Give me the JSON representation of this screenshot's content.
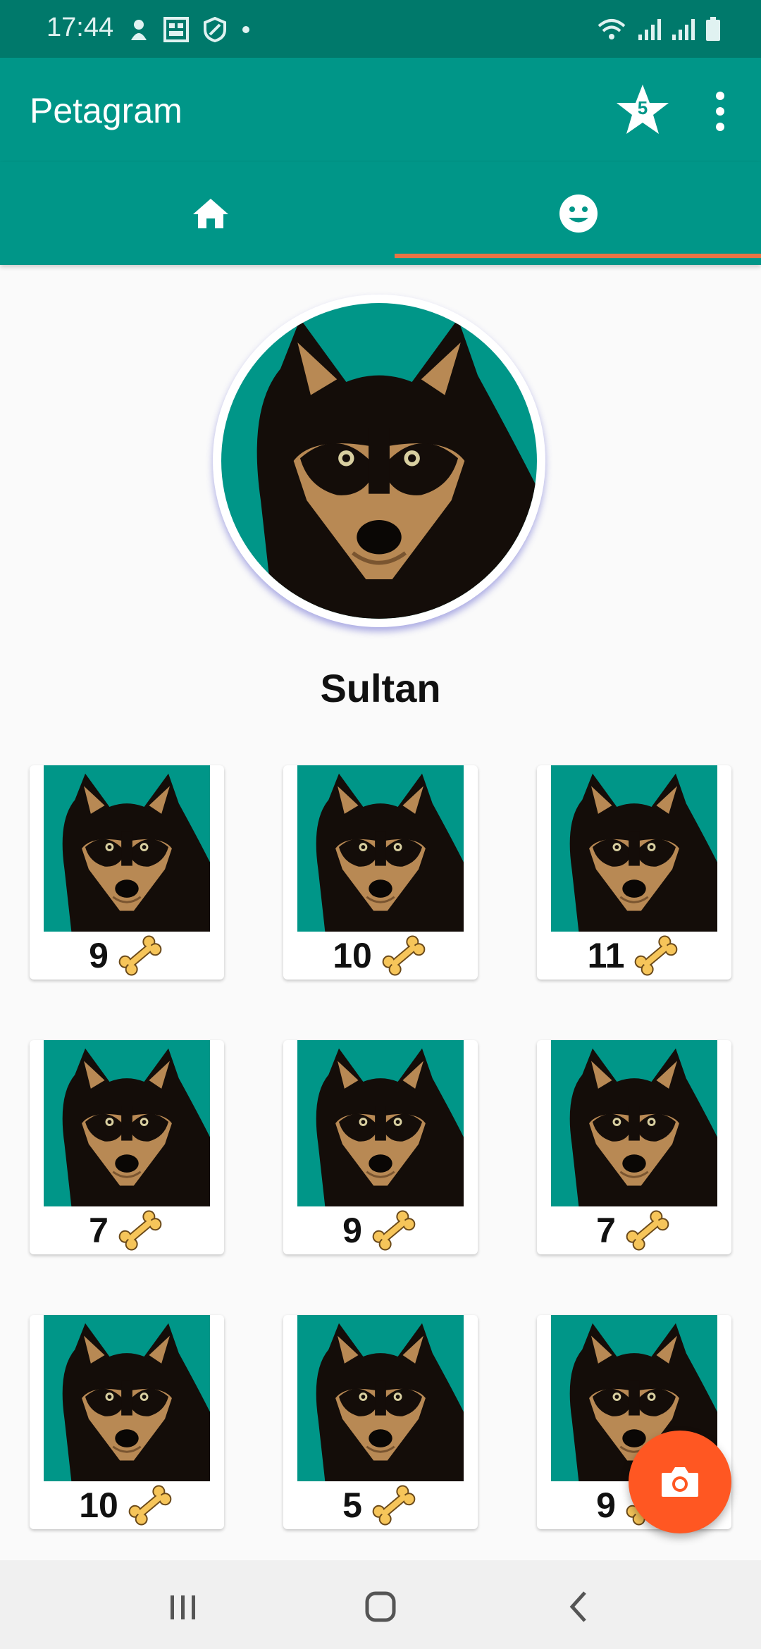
{
  "status_bar": {
    "time": "17:44",
    "left_icons": [
      "notification-icon",
      "calendar-icon",
      "vpn-icon",
      "dot-icon"
    ],
    "right_icons": [
      "wifi-icon",
      "signal-icon",
      "signal-icon",
      "battery-icon"
    ]
  },
  "app_bar": {
    "title": "Petagram",
    "favorites_count": "5",
    "favorites_icon": "star-icon",
    "overflow_icon": "more-vert-icon"
  },
  "tabs": [
    {
      "icon": "home-icon",
      "selected": false
    },
    {
      "icon": "face-icon",
      "selected": true
    }
  ],
  "colors": {
    "primary": "#009688",
    "primary_dark": "#00796b",
    "accent": "#ff5722",
    "tab_indicator": "#e87444"
  },
  "profile": {
    "name": "Sultan",
    "avatar": "dog-avatar-image"
  },
  "photos": [
    {
      "likes": "9"
    },
    {
      "likes": "10"
    },
    {
      "likes": "11"
    },
    {
      "likes": "7"
    },
    {
      "likes": "9"
    },
    {
      "likes": "7"
    },
    {
      "likes": "10"
    },
    {
      "likes": "5"
    },
    {
      "likes": "9"
    }
  ],
  "fab": {
    "icon": "camera-icon"
  },
  "nav_bar": {
    "icons": [
      "recent-apps-icon",
      "home-nav-icon",
      "back-icon"
    ]
  }
}
